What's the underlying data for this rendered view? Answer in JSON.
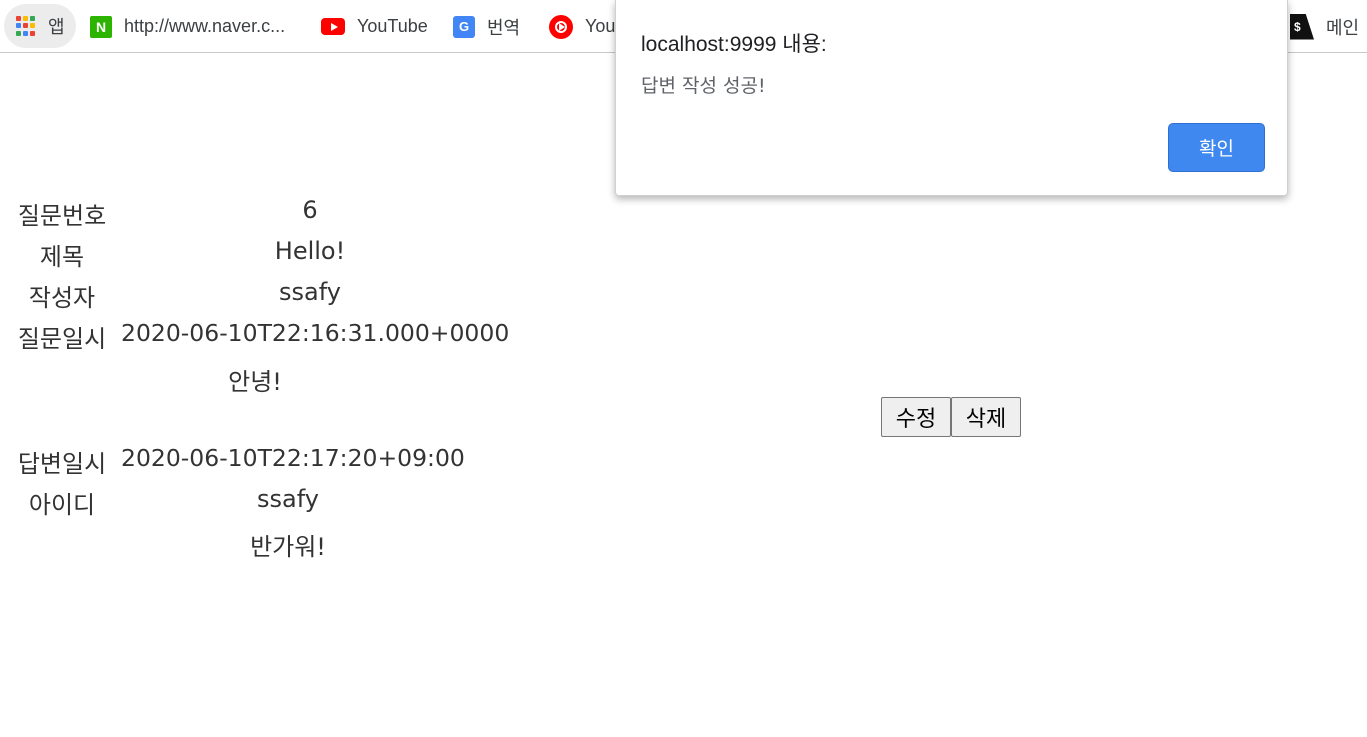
{
  "bookmarks": {
    "apps": "앱",
    "naver": "http://www.naver.c...",
    "youtube": "YouTube",
    "translate": "번역",
    "youtube_music": "You",
    "main": "메인",
    "naver_icon_letter": "N",
    "translate_icon_letter": "G",
    "dollar_icon_letter": "$"
  },
  "question": {
    "number_label": "질문번호",
    "number_value": "6",
    "title_label": "제목",
    "title_value": "Hello!",
    "author_label": "작성자",
    "author_value": "ssafy",
    "date_label": "질문일시",
    "date_value": "2020-06-10T22:16:31.000+0000",
    "content": "안녕!"
  },
  "actions": {
    "edit": "수정",
    "delete": "삭제"
  },
  "answer": {
    "date_label": "답변일시",
    "date_value": "2020-06-10T22:17:20+09:00",
    "id_label": "아이디",
    "id_value": "ssafy",
    "content": "반가워!"
  },
  "alert": {
    "title": "localhost:9999 내용:",
    "message": "답변 작성 성공!",
    "ok": "확인"
  },
  "colors": {
    "alert_button": "#3f88ef",
    "naver_green": "#2db400",
    "youtube_red": "#ff0000"
  }
}
